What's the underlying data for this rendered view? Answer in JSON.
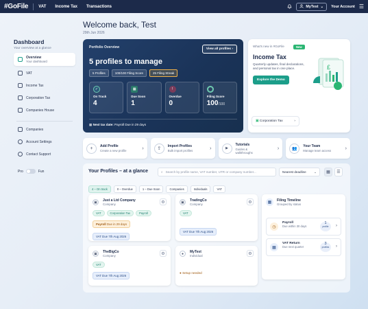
{
  "topbar": {
    "logo": "#GoFile",
    "nav": [
      "VAT",
      "Income Tax",
      "Transactions"
    ],
    "account_pill": "MyTest",
    "account_label": "Your Account"
  },
  "sidebar": {
    "title": "Dashboard",
    "subtitle": "Your overview at a glance",
    "items": [
      {
        "label": "Overview",
        "sub": "Your dashboard"
      },
      {
        "label": "VAT"
      },
      {
        "label": "Income Tax"
      },
      {
        "label": "Corporation Tax"
      },
      {
        "label": "Companies House"
      }
    ],
    "bottom_items": [
      "Companies",
      "Account Settings",
      "Contact Support"
    ],
    "toggle": {
      "left": "Pro",
      "right": "Fun"
    }
  },
  "header": {
    "welcome": "Welcome back, Test",
    "date": "29th Jun 2026"
  },
  "portfolio": {
    "label": "Portfolio Overview",
    "view_all": "View all profiles",
    "headline": "5 profiles to manage",
    "chips": [
      "5 Profiles",
      "100/100 Filing Score",
      "25 Filing Streak"
    ],
    "stats": [
      {
        "label": "On Track",
        "value": "4",
        "suffix": ""
      },
      {
        "label": "Due Soon",
        "value": "1",
        "suffix": ""
      },
      {
        "label": "Overdue",
        "value": "0",
        "suffix": ""
      },
      {
        "label": "Filing Score",
        "value": "100",
        "suffix": "/100"
      }
    ],
    "next_due_label": "Next tax date:",
    "next_due_value": "Payroll Due in 29 days"
  },
  "whats_new": {
    "label": "What's new in #GoFile",
    "badge": "New",
    "title": "Income Tax",
    "desc": "Quarterly updates, final declarations, and personal tax in one place.",
    "button": "Explore the Demo",
    "bottom_link": "Corporation Tax"
  },
  "actions": [
    {
      "title": "Add Profile",
      "sub": "Create a new profile",
      "icon": "+"
    },
    {
      "title": "Import Profiles",
      "sub": "Bulk import profiles",
      "icon": "⇪"
    },
    {
      "title": "Tutorials",
      "sub": "Guides & walkthroughs",
      "icon": "▶"
    },
    {
      "title": "Your Team",
      "sub": "Manage team access",
      "icon": "👥"
    }
  ],
  "profiles": {
    "title": "Your Profiles – at a glance",
    "search_placeholder": "Search by profile name, VAT number, UTR or company number...",
    "sort": "Nearest deadline",
    "filters": [
      "4 – On track",
      "0 – Overdue",
      "1 – Due Soon",
      "Companies",
      "Individuals",
      "VAT"
    ],
    "cards": [
      {
        "name": "Just a Ltd Company",
        "type": "Company",
        "tags": [
          "VAT",
          "Corporation Tax",
          "Payroll"
        ],
        "due": "Payroll",
        "due_rest": "Due in 29 days",
        "vat": "VAT Due 7th Aug 2026"
      },
      {
        "name": "TradingCo",
        "type": "Company",
        "tags": [
          "VAT"
        ],
        "vat": "VAT Due 7th Aug 2026"
      },
      {
        "name": "TheBigCo",
        "type": "Company",
        "tags": [
          "VAT"
        ],
        "vat": "VAT Due 7th Aug 2026"
      },
      {
        "name": "MyTest",
        "type": "Individual",
        "setup": "Setup needed"
      }
    ]
  },
  "timeline": {
    "title": "Filing Timeline",
    "sub": "Grouped by status",
    "rows": [
      {
        "title": "Payroll",
        "sub": "Due within 30 days",
        "count": "1",
        "unit": "profile"
      },
      {
        "title": "VAT Return",
        "sub": "Due next quarter",
        "count": "3",
        "unit": "profiles"
      }
    ]
  }
}
